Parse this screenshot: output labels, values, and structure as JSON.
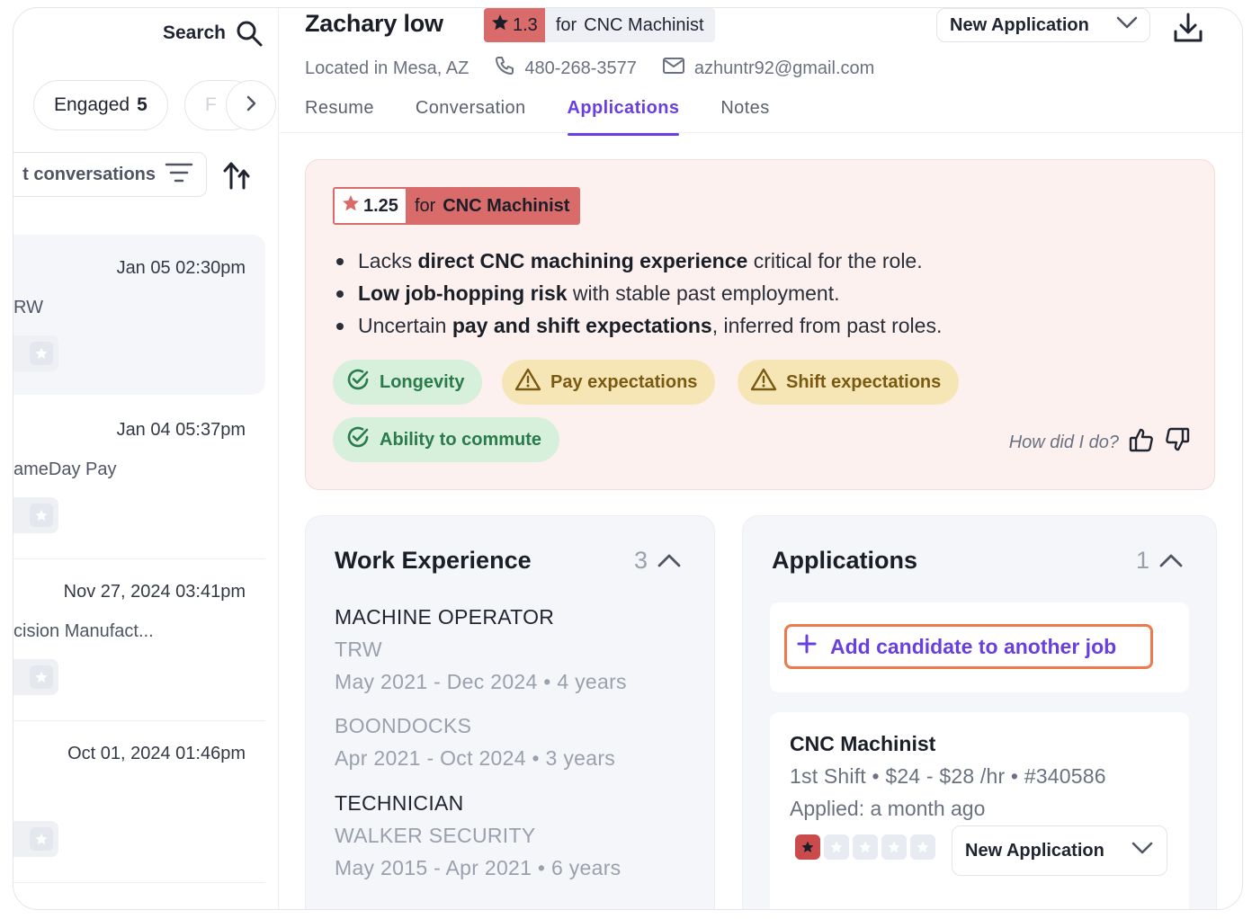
{
  "sidebar": {
    "search_label": "Search",
    "pills": [
      {
        "label": "Engaged",
        "count": "5"
      },
      {
        "label": "F"
      }
    ],
    "filter_label": "t conversations",
    "conversations": [
      {
        "date": "Jan 05 02:30pm",
        "company": "RW"
      },
      {
        "date": "Jan 04 05:37pm",
        "company": "ameDay Pay"
      },
      {
        "date": "Nov 27, 2024 03:41pm",
        "company": "cision Manufact..."
      },
      {
        "date": "Oct 01, 2024 01:46pm",
        "company": ""
      }
    ]
  },
  "candidate": {
    "name": "Zachary low",
    "score": "1.3",
    "for_word": "for",
    "job": "CNC Machinist",
    "status": "New Application",
    "location": "Located in Mesa, AZ",
    "phone": "480-268-3577",
    "email": "azhuntr92@gmail.com"
  },
  "tabs": [
    {
      "label": "Resume",
      "active": false
    },
    {
      "label": "Conversation",
      "active": false
    },
    {
      "label": "Applications",
      "active": true
    },
    {
      "label": "Notes",
      "active": false
    }
  ],
  "ai_summary": {
    "score": "1.25",
    "for_word": "for",
    "job": "CNC Machinist",
    "bullets": [
      {
        "pre": "Lacks ",
        "bold": "direct CNC machining experience",
        "post": " critical for the role."
      },
      {
        "pre": "",
        "bold": "Low job-hopping risk",
        "post": " with stable past employment."
      },
      {
        "pre": "Uncertain ",
        "bold": "pay and shift expectations",
        "post": ", inferred from past roles."
      }
    ],
    "tags": [
      {
        "label": "Longevity",
        "kind": "check"
      },
      {
        "label": "Pay expectations",
        "kind": "warn"
      },
      {
        "label": "Shift expectations",
        "kind": "warn"
      },
      {
        "label": "Ability to commute",
        "kind": "check"
      }
    ],
    "feedback_prompt": "How did I do?"
  },
  "work_experience": {
    "title": "Work Experience",
    "count": "3",
    "jobs": [
      {
        "title": "MACHINE OPERATOR",
        "company": "TRW",
        "dates": "May 2021 - Dec 2024 • 4 years"
      },
      {
        "title": "",
        "company": "BOONDOCKS",
        "dates": "Apr 2021 - Oct 2024 • 3 years"
      },
      {
        "title": "TECHNICIAN",
        "company": "WALKER SECURITY",
        "dates": "May 2015 - Apr 2021 • 6 years"
      }
    ]
  },
  "applications": {
    "title": "Applications",
    "count": "1",
    "add_label": "Add candidate to another job",
    "items": [
      {
        "job": "CNC Machinist",
        "meta": "1st Shift • $24 - $28 /hr • #340586",
        "applied": "Applied: a month ago",
        "rating": 1,
        "rating_max": 5,
        "status": "New Application"
      }
    ]
  },
  "colors": {
    "accent": "#6a3fe0",
    "score_red": "#d96b6b",
    "ai_bg": "#fdf1ef",
    "tag_green": "#d6f0dc",
    "tag_yellow": "#f7e6b5",
    "add_border": "#ec7a4a"
  }
}
